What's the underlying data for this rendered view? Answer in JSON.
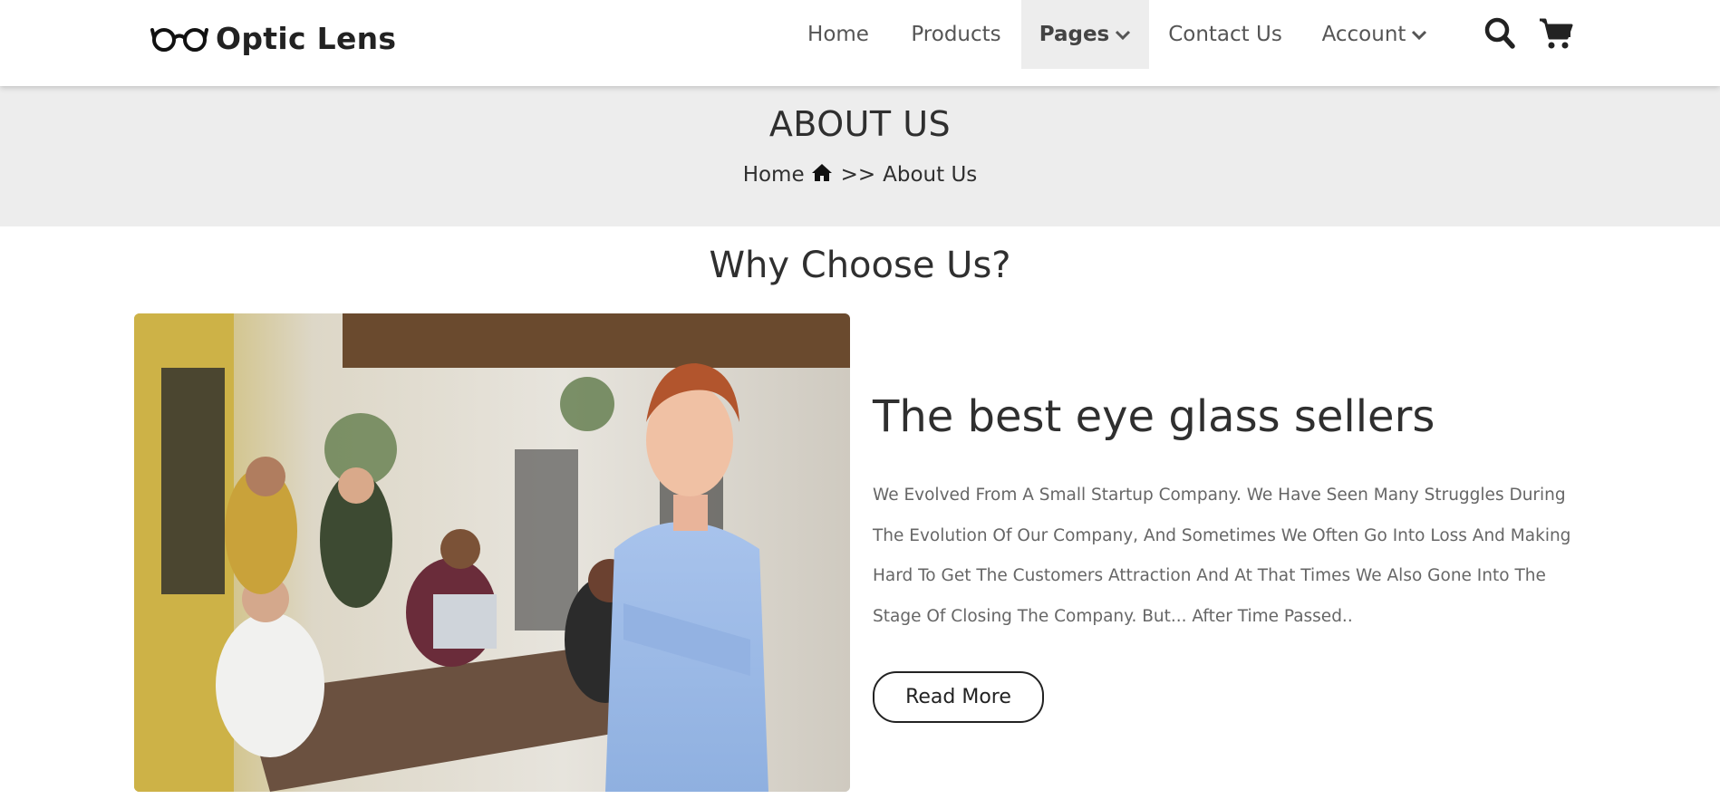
{
  "brand": {
    "name": "Optic Lens",
    "logo_icon": "glasses-icon"
  },
  "nav": {
    "items": [
      {
        "label": "Home"
      },
      {
        "label": "Products"
      },
      {
        "label": "Pages",
        "active": true,
        "icon": "chevron-down-icon"
      },
      {
        "label": "Contact Us"
      },
      {
        "label": "Account",
        "icon": "chevron-down-icon"
      }
    ],
    "search_icon": "search-icon",
    "cart_icon": "cart-icon"
  },
  "banner": {
    "title": "ABOUT US",
    "breadcrumb": {
      "home": "Home",
      "home_icon": "home-icon",
      "separator": ">>",
      "current": "About Us"
    }
  },
  "section": {
    "title": "Why Choose Us?",
    "heading": "The best eye glass sellers",
    "text": "We Evolved From A Small Startup Company. We Have Seen Many Struggles During The Evolution Of Our Company, And Sometimes We Often Go Into Loss And Making Hard To Get The Customers Attraction And At That Times We Also Gone Into The Stage Of Closing The Company. But... After Time Passed..",
    "button": "Read More"
  },
  "colors": {
    "banner_bg": "#ededed",
    "active_nav_bg": "#ededed",
    "text": "#2f2f2f",
    "muted": "#666666"
  }
}
